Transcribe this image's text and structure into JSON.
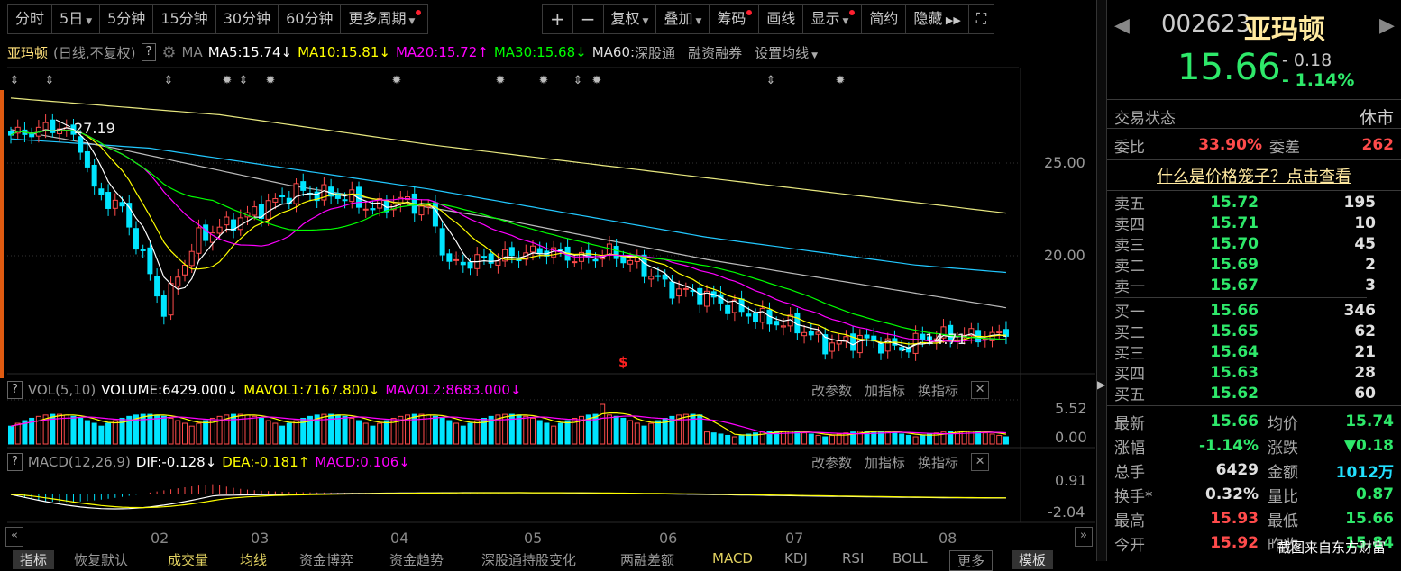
{
  "toolbar": {
    "left": [
      "分时",
      "5日",
      "5分钟",
      "15分钟",
      "30分钟",
      "60分钟",
      "更多周期"
    ],
    "right": [
      "+",
      "−",
      "复权",
      "叠加",
      "筹码",
      "画线",
      "显示",
      "简约",
      "隐藏"
    ],
    "fullscreen_icon": "expand-icon"
  },
  "ma_bar": {
    "name": "亚玛顿",
    "mode": "(日线,不复权)",
    "help": "?",
    "ma": "MA",
    "ma5": "MA5:15.74",
    "ma10": "MA10:15.81",
    "ma20": "MA20:15.72",
    "ma30": "MA30:15.68",
    "ma60": "MA60:",
    "sgt": "深股通",
    "rzrq": "融资融券",
    "set": "设置均线"
  },
  "price_chart": {
    "high_label": "27.19",
    "low_label": "14.71",
    "axis": [
      "25.00",
      "20.00"
    ],
    "signal": "$",
    "keyframes": [
      [
        0,
        26.5
      ],
      [
        7,
        27
      ],
      [
        10,
        26
      ],
      [
        12,
        23.5
      ],
      [
        16,
        22.5
      ],
      [
        20,
        19
      ],
      [
        22,
        17
      ],
      [
        24,
        19
      ],
      [
        27,
        21
      ],
      [
        33,
        22
      ],
      [
        41,
        23.5
      ],
      [
        48,
        23.2
      ],
      [
        52,
        22.5
      ],
      [
        56,
        23
      ],
      [
        60,
        22.5
      ],
      [
        63,
        19.5
      ],
      [
        68,
        19.8
      ],
      [
        72,
        20
      ],
      [
        77,
        20.3
      ],
      [
        82,
        19.8
      ],
      [
        86,
        20.2
      ],
      [
        90,
        19.5
      ],
      [
        95,
        18.2
      ],
      [
        100,
        17.8
      ],
      [
        105,
        17
      ],
      [
        109,
        16.5
      ],
      [
        113,
        16.2
      ],
      [
        117,
        15.2
      ],
      [
        122,
        15.5
      ],
      [
        128,
        15
      ],
      [
        132,
        15.7
      ],
      [
        143,
        15.66
      ]
    ],
    "long_ma_yellow": [
      [
        0,
        28.5
      ],
      [
        30,
        27.6
      ],
      [
        60,
        26
      ],
      [
        100,
        24.2
      ],
      [
        143,
        22.3
      ]
    ],
    "long_ma_cyan": [
      [
        0,
        26.3
      ],
      [
        20,
        25.8
      ],
      [
        60,
        23.6
      ],
      [
        100,
        21
      ],
      [
        130,
        19.5
      ],
      [
        143,
        19.1
      ]
    ],
    "long_ma_white": [
      [
        0,
        26.8
      ],
      [
        15,
        25.8
      ],
      [
        40,
        23.8
      ],
      [
        70,
        22
      ],
      [
        100,
        19.8
      ],
      [
        143,
        17.2
      ]
    ]
  },
  "vol": {
    "help": "?",
    "name": "VOL(5,10)",
    "volume": "VOLUME:6429.000",
    "mavol1": "MAVOL1:7167.800",
    "mavol2": "MAVOL2:8683.000",
    "axis": [
      "5.52",
      "0.00"
    ]
  },
  "macd": {
    "help": "?",
    "name": "MACD(12,26,9)",
    "dif": "DIF:-0.128",
    "dea": "DEA:-0.181",
    "macd": "MACD:0.106",
    "axis": [
      "0.91",
      "-2.04"
    ]
  },
  "panel_buttons": [
    "改参数",
    "加指标",
    "换指标"
  ],
  "months": [
    "02",
    "03",
    "04",
    "05",
    "06",
    "07",
    "08"
  ],
  "tabs": [
    "指标",
    "恢复默认",
    "成交量",
    "均线",
    "资金博弈",
    "资金趋势",
    "深股通持股变化",
    "两融差额",
    "MACD",
    "KDJ",
    "RSI",
    "BOLL",
    "更多",
    "模板"
  ],
  "quote": {
    "code": "002623",
    "name": "亚玛顿",
    "price": "15.66",
    "change": "- 0.18",
    "pct": "- 1.14%",
    "status_label": "交易状态",
    "status": "休市",
    "wb_label": "委比",
    "wb": "33.90%",
    "wc_label": "委差",
    "wc": "262",
    "link": "什么是价格笼子？点击查看",
    "asks": [
      [
        "卖五",
        "15.72",
        "195"
      ],
      [
        "卖四",
        "15.71",
        "10"
      ],
      [
        "卖三",
        "15.70",
        "45"
      ],
      [
        "卖二",
        "15.69",
        "2"
      ],
      [
        "卖一",
        "15.67",
        "3"
      ]
    ],
    "bids": [
      [
        "买一",
        "15.66",
        "346"
      ],
      [
        "买二",
        "15.65",
        "62"
      ],
      [
        "买三",
        "15.64",
        "21"
      ],
      [
        "买四",
        "15.63",
        "28"
      ],
      [
        "买五",
        "15.62",
        "60"
      ]
    ],
    "stats": [
      [
        "最新",
        "15.66",
        "g",
        "均价",
        "15.74",
        "g"
      ],
      [
        "涨幅",
        "-1.14%",
        "g",
        "涨跌",
        "▼0.18",
        "g"
      ],
      [
        "总手",
        "6429",
        "w",
        "金额",
        "1012万",
        "c"
      ],
      [
        "换手*",
        "0.32%",
        "w",
        "量比",
        "0.87",
        "g"
      ],
      [
        "最高",
        "15.93",
        "r",
        "最低",
        "15.66",
        "g"
      ],
      [
        "今开",
        "15.92",
        "r",
        "昨收",
        "15.84",
        "g"
      ]
    ]
  },
  "watermark": "截图来自东方财富",
  "colors": {
    "up": "#ff4b4b",
    "down": "#00e5ff",
    "ma5": "#ffffff",
    "ma10": "#ffff00",
    "ma20": "#ff00ff",
    "ma30": "#00ff00"
  }
}
